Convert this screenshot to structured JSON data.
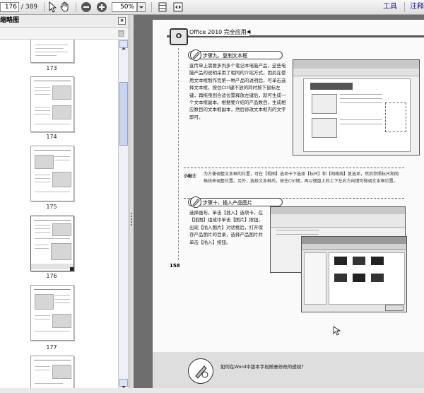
{
  "toolbar": {
    "current_page": "176",
    "page_total": "/ 389",
    "zoom": "50%",
    "tools_label": "工具",
    "comment_label": "注释"
  },
  "sidebar": {
    "title": "缩略图",
    "close_glyph": "×",
    "thumbnails": [
      {
        "label": "173"
      },
      {
        "label": "174"
      },
      {
        "label": "175"
      },
      {
        "label": "176",
        "selected": true
      },
      {
        "label": "177"
      }
    ]
  },
  "document": {
    "header_title": "Office 2010 完全应用",
    "header_arrow": "◀",
    "logo_text": "O",
    "step9_title": "步骤九、复制文本框",
    "step9_paragraph": "宣传单上需要多列多个笔记本电脑产品，这些电脑产品的说明采用了相同的介绍方式，因此在使用文本框制作完第一种产品的说明后，可单击选择文本框，按住Ctrl键不放的同时按下鼠标左键，再拖曳到合适位置释放左键后，就可生成一个文本框副本。根据要介绍的产品数目，生成相应数目的文本框副本，然后修改文本框内的文字即可。",
    "note_tag": "小贴士",
    "note_text": "为方便调整文本框的位置，可在【视图】选项卡下选择【标尺】和【网格线】复选项，然后参照标尺和网格线来调整位置。另外，选择文本框后，按住Ctrl键，再以键盘上的上下左右方向键可微调文本框位置。",
    "step10_title": "步骤十、插入产品图片",
    "step10_paragraph": "选择画布，单击【插入】选项卡，在【插图】组成中单击【图片】按钮，出现【插入图片】对话框后，打开保存产品图片的目录，选择产品图片并单击【插入】按钮。",
    "page_number": "158",
    "footer_text": "如何在Word中版本字段随意修改的透视？"
  }
}
